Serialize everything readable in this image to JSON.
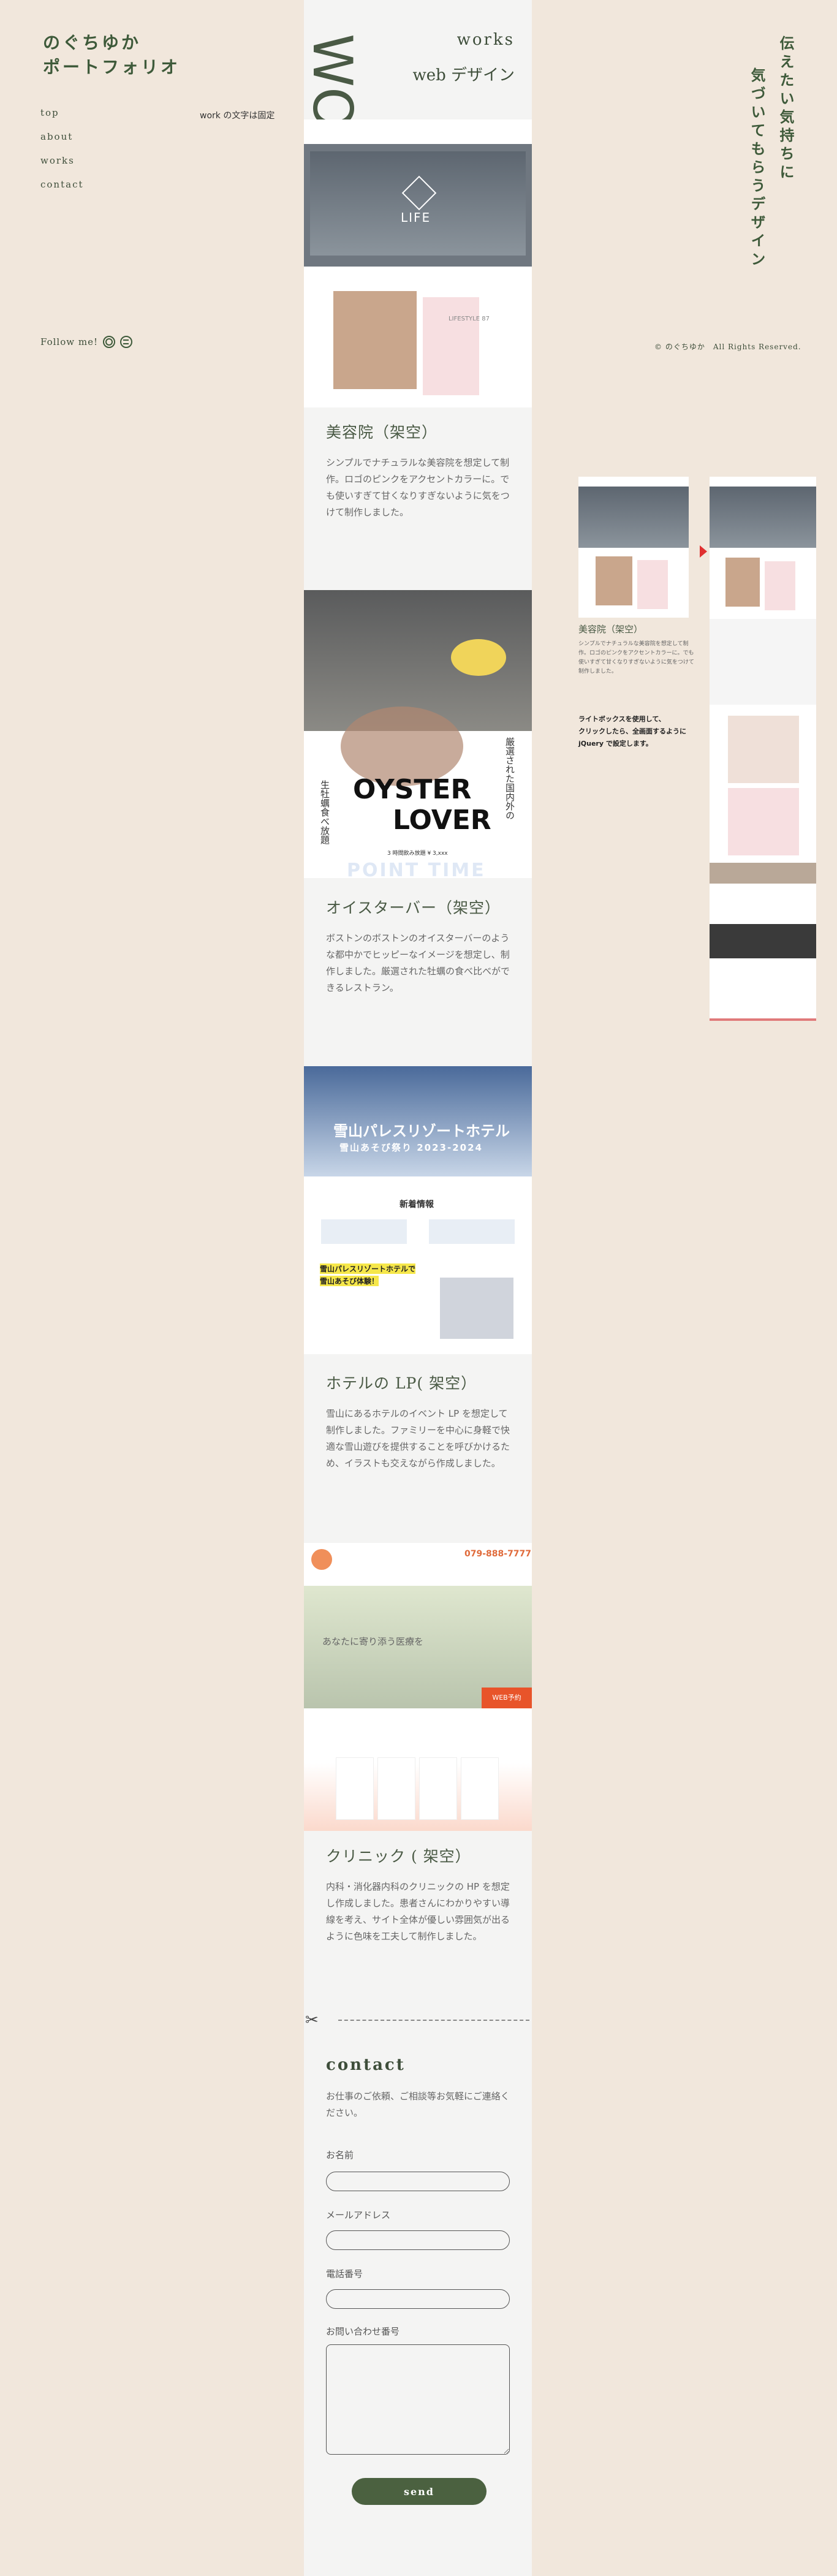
{
  "brand": {
    "line1": "のぐちゆか",
    "line2": "ポートフォリオ"
  },
  "nav": [
    "top",
    "about",
    "works",
    "contact"
  ],
  "note": "work の文字は固定",
  "follow": "Follow me!",
  "copyright": "© のぐちゆか　All Rights Reserved.",
  "tagline": {
    "col1": "伝えたい気持ちに",
    "col2": "気づいてもらうデザイン"
  },
  "works_vertical": "WORKS",
  "works_title": "works",
  "works_sub": "web デザイン",
  "works_items": [
    {
      "title": "美容院（架空）",
      "desc": "シンプルでナチュラルな美容院を想定して制作。ロゴのピンクをアクセントカラーに。でも使いすぎて甘くなりすぎないように気をつけて制作しました。",
      "shot_text": "LIFE",
      "shot_sub": "LIFESTYLE 87"
    },
    {
      "title": "オイスターバー（架空）",
      "desc": "ボストンのボストンのオイスターバーのような都中かでヒッピーなイメージを想定し、制作しました。厳選された牡蠣の食べ比べができるレストラン。",
      "shot_text1": "OYSTER",
      "shot_text2": "LOVER",
      "shot_side1": "厳選された国内外の",
      "shot_side2": "生牡蠣食べ放題",
      "shot_time": "POINT TIME",
      "shot_caption": "3 時間飲み放題 ¥ 3,xxx"
    },
    {
      "title": "ホテルの LP( 架空）",
      "desc": "雪山にあるホテルのイベント LP を想定して制作しました。ファミリーを中心に身軽で快適な雪山遊びを提供することを呼びかけるため、イラストも交えながら作成しました。",
      "shot_title": "雪山パレスリゾートホテル",
      "shot_sub": "雪山あそび祭り 2023-2024",
      "shot_news": "新着情報",
      "shot_hl1": "雪山パレスリゾートホテルで",
      "shot_hl2": "雪山あそび体験！"
    },
    {
      "title": "クリニック ( 架空）",
      "desc": "内科・消化器内科のクリニックの HP を想定し作成しました。患者さんにわかりやすい導線を考え、サイト全体が優しい雰囲気が出るように色味を工夫して制作しました。",
      "shot_phone": "079-888-7777",
      "shot_hero": "あなたに寄り添う医療を",
      "shot_btn": "WEB予約"
    }
  ],
  "side_preview": {
    "title": "美容院（架空）",
    "desc": "シンプルでナチュラルな美容院を想定して制作。ロゴのピンクをアクセントカラーに。でも使いすぎて甘くなりすぎないように気をつけて制作しました。",
    "note1": "ライトボックスを使用して、",
    "note2": "クリックしたら、全画面するように",
    "note3": "jQuery で設定します。"
  },
  "contact": {
    "title": "contact",
    "intro": "お仕事のご依頼、ご相談等お気軽にご連絡ください。",
    "name": "お名前",
    "email": "メールアドレス",
    "phone": "電話番号",
    "inquiry": "お問い合わせ番号",
    "send": "send"
  },
  "colors": {
    "bg": "#f1e7dc",
    "panel": "#f4f4f3",
    "accent": "#4b6140",
    "pink": "#f7dfe1",
    "red": "#e03030"
  }
}
